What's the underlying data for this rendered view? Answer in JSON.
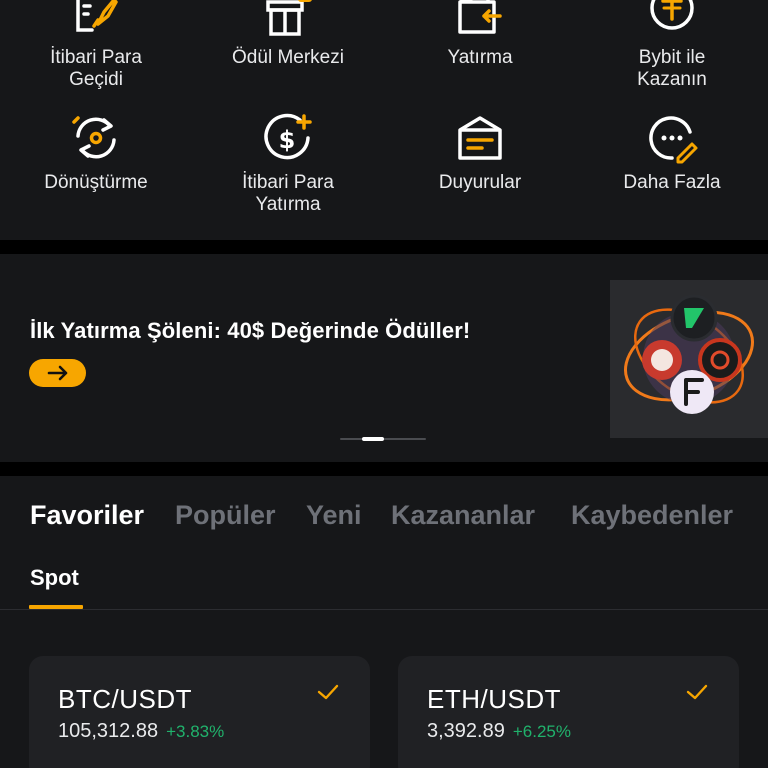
{
  "shortcuts": [
    {
      "icon": "rocket-doc-icon",
      "label": "İtibari Para\nGeçidi"
    },
    {
      "icon": "gift-box-icon",
      "label": "Ödül Merkezi"
    },
    {
      "icon": "wallet-deposit-icon",
      "label": "Yatırma"
    },
    {
      "icon": "tether-coin-icon",
      "label": "Bybit ile\nKazanın"
    },
    {
      "icon": "convert-icon",
      "label": "Dönüştürme"
    },
    {
      "icon": "dollar-plus-icon",
      "label": "İtibari Para\nYatırma"
    },
    {
      "icon": "announcement-icon",
      "label": "Duyurular"
    },
    {
      "icon": "more-chat-icon",
      "label": "Daha Fazla"
    }
  ],
  "banner": {
    "title": "İlk Yatırma Şöleni: 40$ Değerinde Ödüller!",
    "button_icon": "arrow-right-icon",
    "image_icon": "crypto-tokens-icon"
  },
  "market": {
    "tabs": [
      "Favoriler",
      "Popüler",
      "Yeni",
      "Kazananlar",
      "Kaybedenler"
    ],
    "active_tab": "Favoriler",
    "subtab": "Spot"
  },
  "pairs": [
    {
      "symbol": "BTC/USDT",
      "price": "105,312.88",
      "change": "+3.83%"
    },
    {
      "symbol": "ETH/USDT",
      "price": "3,392.89",
      "change": "+6.25%"
    }
  ],
  "colors": {
    "accent": "#f7a600",
    "positive": "#20b26c",
    "panel": "#161719",
    "card": "#202124",
    "inactive_tab": "#6e7178"
  }
}
